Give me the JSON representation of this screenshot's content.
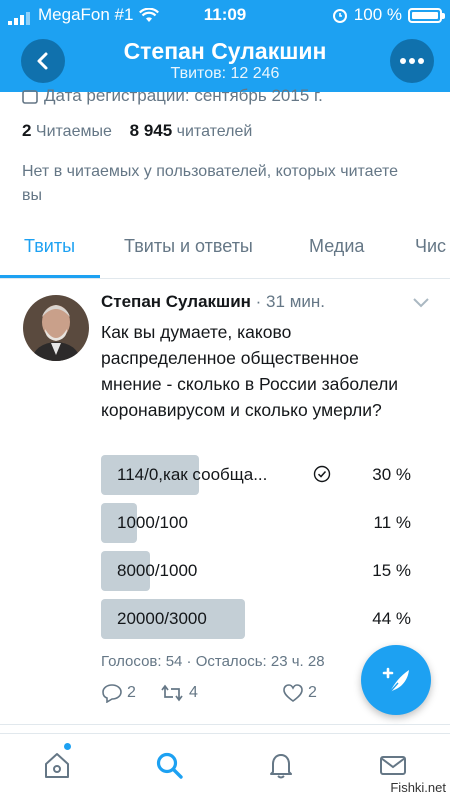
{
  "statusbar": {
    "carrier": "MegaFon #1",
    "time": "11:09",
    "battery": "100 %"
  },
  "header": {
    "name": "Степан Сулакшин",
    "subtitle": "Твитов: 12 246"
  },
  "profile": {
    "registration_cut": "Дата регистрации: сентябрь 2015 г.",
    "following_count": "2",
    "following_label": "Читаемые",
    "followers_count": "8 945",
    "followers_label": "читателей",
    "notice": "Нет в читаемых у пользователей, которых читаете вы"
  },
  "tabs": [
    "Твиты",
    "Твиты и ответы",
    "Медиа",
    "Чис"
  ],
  "tweet": {
    "author": "Степан Сулакшин",
    "time": "· 31 мин.",
    "text": "Как вы думаете, каково распределенное общественное мнение - сколько в России заболели коронавирусом и сколько умерли?",
    "poll": [
      {
        "label": "114/0,как сообща...",
        "percent": "30 %",
        "share": 0.3,
        "voted": true
      },
      {
        "label": "1000/100",
        "percent": "11 %",
        "share": 0.11,
        "voted": false
      },
      {
        "label": "8000/1000",
        "percent": "15 %",
        "share": 0.15,
        "voted": false
      },
      {
        "label": "20000/3000",
        "percent": "44 %",
        "share": 0.44,
        "voted": false
      }
    ],
    "meta": "Голосов: 54 · Осталось: 23 ч. 28",
    "replies": "2",
    "retweets": "4",
    "likes": "2"
  },
  "watermark": "Fishki.net",
  "colors": {
    "accent": "#1da1f2",
    "poll_bar": "#c4cfd6",
    "muted": "#657786"
  }
}
